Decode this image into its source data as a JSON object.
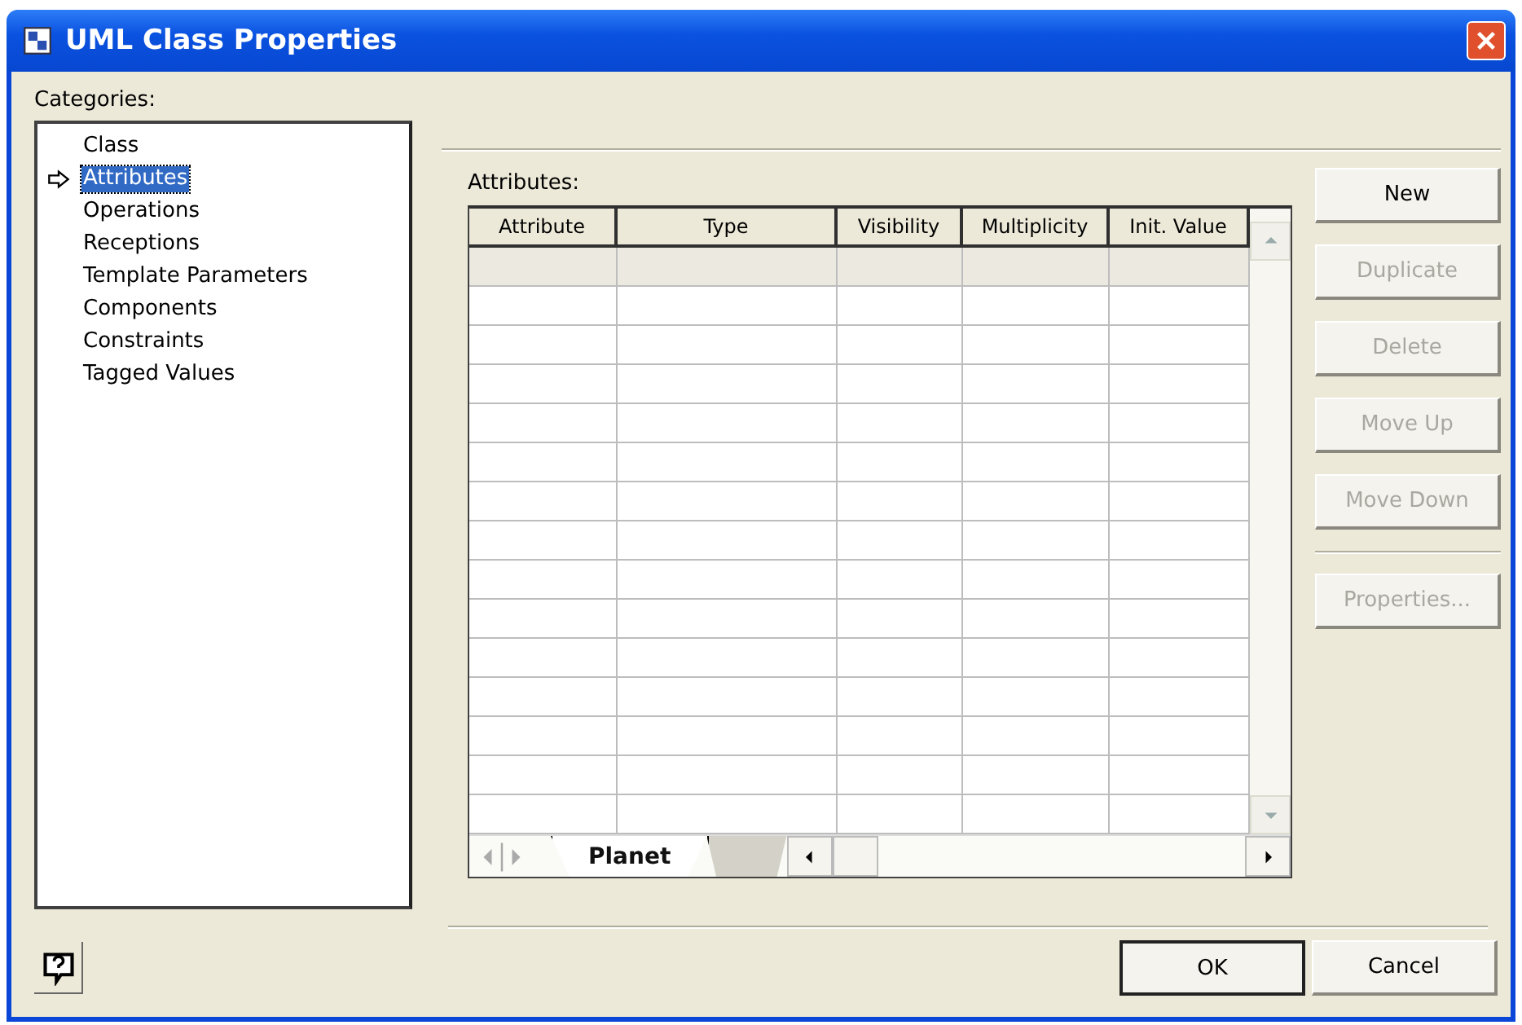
{
  "window": {
    "title": "UML Class Properties"
  },
  "categories": {
    "label": "Categories:",
    "items": [
      {
        "label": "Class",
        "selected": false
      },
      {
        "label": "Attributes",
        "selected": true
      },
      {
        "label": "Operations",
        "selected": false
      },
      {
        "label": "Receptions",
        "selected": false
      },
      {
        "label": "Template Parameters",
        "selected": false
      },
      {
        "label": "Components",
        "selected": false
      },
      {
        "label": "Constraints",
        "selected": false
      },
      {
        "label": "Tagged Values",
        "selected": false
      }
    ]
  },
  "attributes": {
    "label": "Attributes:",
    "columns": [
      "Attribute",
      "Type",
      "Visibility",
      "Multiplicity",
      "Init. Value"
    ],
    "sheet_tabs": [
      {
        "label": "Planet",
        "selected": true
      }
    ]
  },
  "side_buttons": [
    {
      "label": "New",
      "disabled": false
    },
    {
      "label": "Duplicate",
      "disabled": true
    },
    {
      "label": "Delete",
      "disabled": true
    },
    {
      "label": "Move Up",
      "disabled": true
    },
    {
      "label": "Move Down",
      "disabled": true
    },
    {
      "label": "Properties...",
      "disabled": true,
      "kind": "separated"
    }
  ],
  "footer_buttons": [
    {
      "label": "OK",
      "default": true
    },
    {
      "label": "Cancel",
      "default": false
    }
  ]
}
